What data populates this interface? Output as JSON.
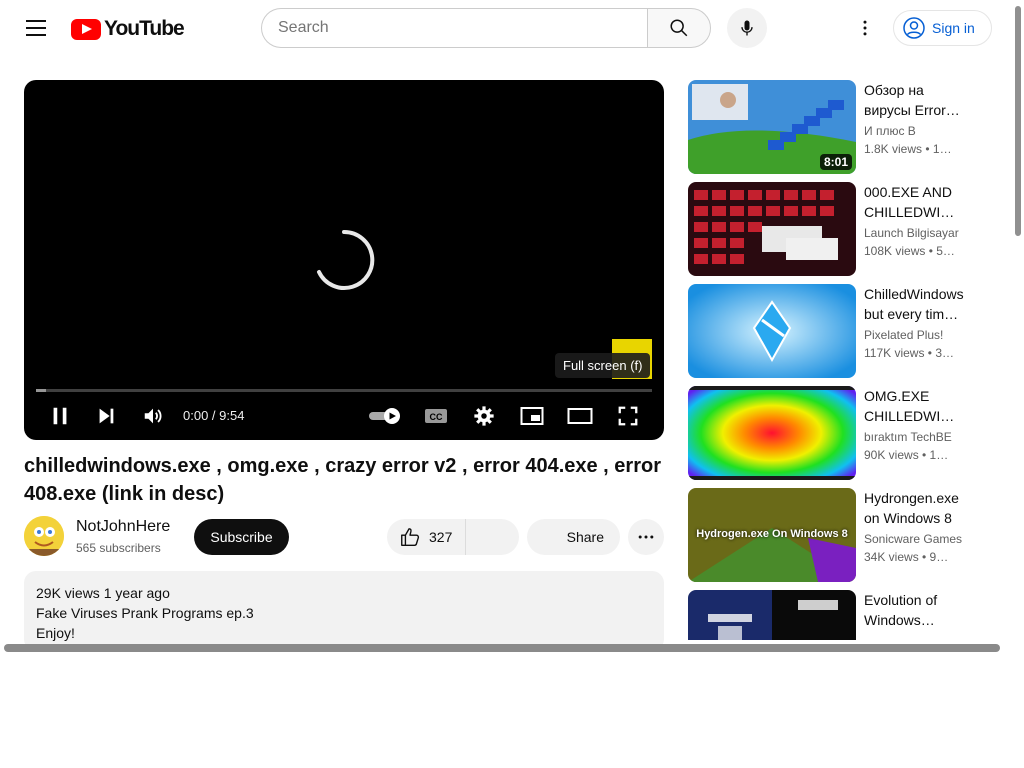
{
  "header": {
    "logo_text": "YouTube",
    "search_placeholder": "Search",
    "sign_in_label": "Sign in"
  },
  "player": {
    "time": "0:00 / 9:54",
    "tooltip": "Full screen (f)",
    "progress_fraction": 0.016,
    "spinner_color": "#e8e8e8"
  },
  "video": {
    "title": "chilledwindows.exe , omg.exe , crazy error v2 , error 404.exe , error 408.exe (link in desc)",
    "channel_name": "NotJohnHere",
    "subscribers": "565 subscribers",
    "subscribe_label": "Subscribe",
    "like_count": "327",
    "share_label": "Share",
    "description": {
      "meta": "29K views  1 year ago",
      "line1": "Fake Viruses Prank Programs ep.3",
      "line2": "Enjoy!"
    }
  },
  "recommendations": [
    {
      "title": "Обзор на вирусы Error…",
      "channel": "И плюс В",
      "stats": "1.8K views  • 1…",
      "duration": "8:01",
      "thumb_color": "#3f8f2a",
      "thumb_caption": ""
    },
    {
      "title": "000.EXE AND CHILLEDWI…",
      "channel": "Launch Bilgisayar",
      "stats": "108K views  • 5…",
      "duration": "",
      "thumb_color": "#c4202e",
      "thumb_caption": ""
    },
    {
      "title": "ChilledWindows but every tim…",
      "channel": "Pixelated Plus!",
      "stats": "117K views  • 3…",
      "duration": "",
      "thumb_color": "#2f9fe0",
      "thumb_caption": ""
    },
    {
      "title": "OMG.EXE CHILLEDWI…",
      "channel": "bıraktım TechBE",
      "stats": "90K views  • 1…",
      "duration": "",
      "thumb_color": "#ff2a3a",
      "thumb_caption": ""
    },
    {
      "title": "Hydrongen.exe on Windows 8",
      "channel": "Sonicware Games",
      "stats": "34K views  • 9…",
      "duration": "",
      "thumb_color": "#8a7a20",
      "thumb_caption": "Hydrogen.exe On Windows 8"
    },
    {
      "title": "Evolution of Windows…",
      "channel": "",
      "stats": "",
      "duration": "",
      "thumb_color": "#1a2a6a",
      "thumb_caption": ""
    }
  ]
}
